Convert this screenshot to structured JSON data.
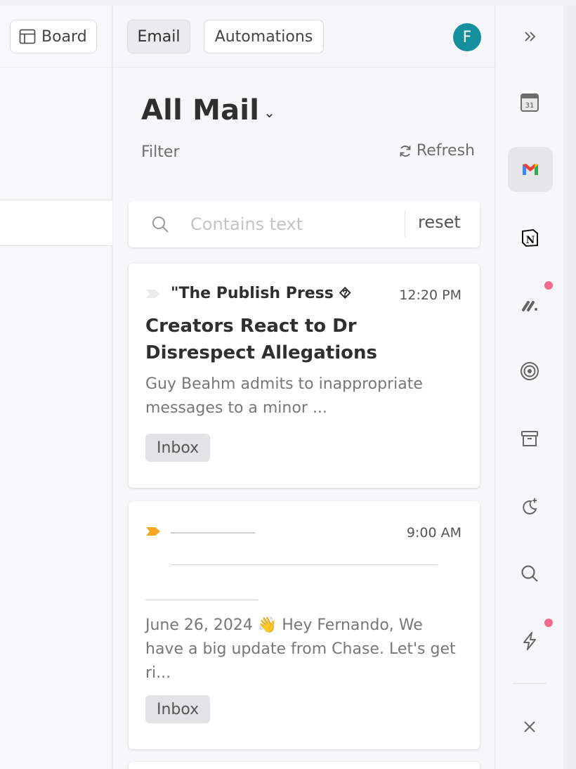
{
  "left": {
    "board_label": "Board"
  },
  "header": {
    "tabs": [
      {
        "label": "Email"
      },
      {
        "label": "Automations"
      }
    ],
    "avatar_initial": "F"
  },
  "mail": {
    "title": "All Mail",
    "filter_label": "Filter",
    "refresh_label": "Refresh",
    "search": {
      "placeholder": "Contains text",
      "value": "",
      "reset_label": "reset"
    },
    "items": [
      {
        "sender": "\"The Publish Press ⯑",
        "time": "12:20 PM",
        "subject": "Creators React to Dr Disrespect Allegations",
        "snippet": "Guy Beahm admits to inappropriate messages to a minor ...",
        "label": "Inbox",
        "flag_color": "#ebebeb"
      },
      {
        "sender": "",
        "time": "9:00 AM",
        "subject": "",
        "snippet": "June 26, 2024 👋 Hey Fernando, We have a big update from Chase. Let's get ri...",
        "label": "Inbox",
        "flag_color": "#f5a623"
      }
    ]
  },
  "rail": {
    "icons": [
      "collapse-icon",
      "google-calendar-icon",
      "gmail-icon",
      "notion-icon",
      "linear-icon",
      "target-icon",
      "archive-icon",
      "moon-sparkle-icon",
      "search-icon",
      "lightning-icon",
      "close-icon"
    ],
    "notification_color": "#f2698f"
  }
}
